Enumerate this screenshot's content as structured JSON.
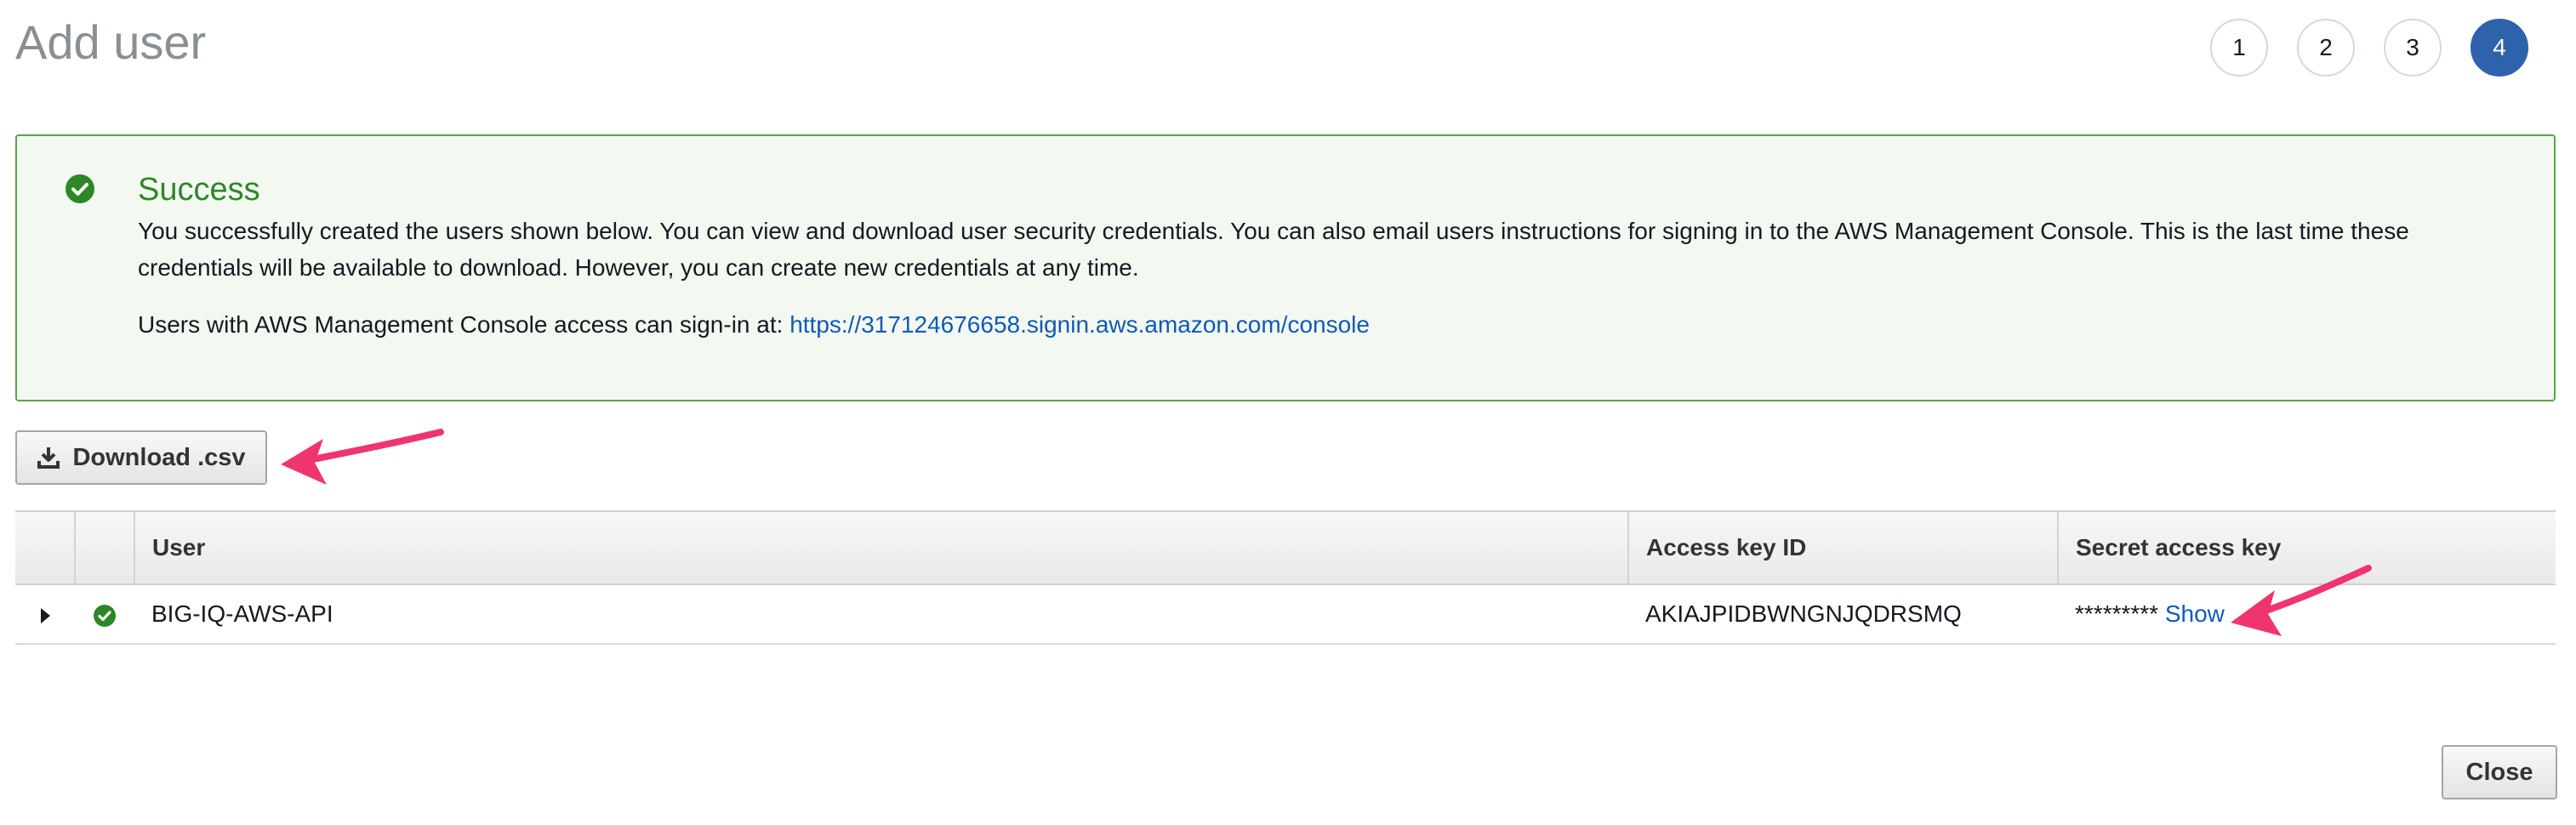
{
  "page": {
    "title": "Add user"
  },
  "steps": [
    {
      "label": "1",
      "active": false
    },
    {
      "label": "2",
      "active": false
    },
    {
      "label": "3",
      "active": false
    },
    {
      "label": "4",
      "active": true
    }
  ],
  "alert": {
    "title": "Success",
    "body": "You successfully created the users shown below. You can view and download user security credentials. You can also email users instructions for signing in to the AWS Management Console. This is the last time these credentials will be available to download. However, you can create new credentials at any time.",
    "console_prefix": "Users with AWS Management Console access can sign-in at: ",
    "console_link": "https://317124676658.signin.aws.amazon.com/console",
    "icon": "check-circle-icon"
  },
  "toolbar": {
    "download_label": "Download .csv",
    "download_icon": "download-icon"
  },
  "table": {
    "columns": [
      "User",
      "Access key ID",
      "Secret access key"
    ],
    "rows": [
      {
        "user": "BIG-IQ-AWS-API",
        "access_key_id": "AKIAJPIDBWNGNJQDRSMQ",
        "secret_masked": "*********",
        "show_label": "Show"
      }
    ]
  },
  "footer": {
    "close_label": "Close"
  },
  "colors": {
    "success": "#2d8727",
    "accent": "#2e62ab",
    "link": "#0f5ab5",
    "annotation_arrow": "#f0356e"
  }
}
